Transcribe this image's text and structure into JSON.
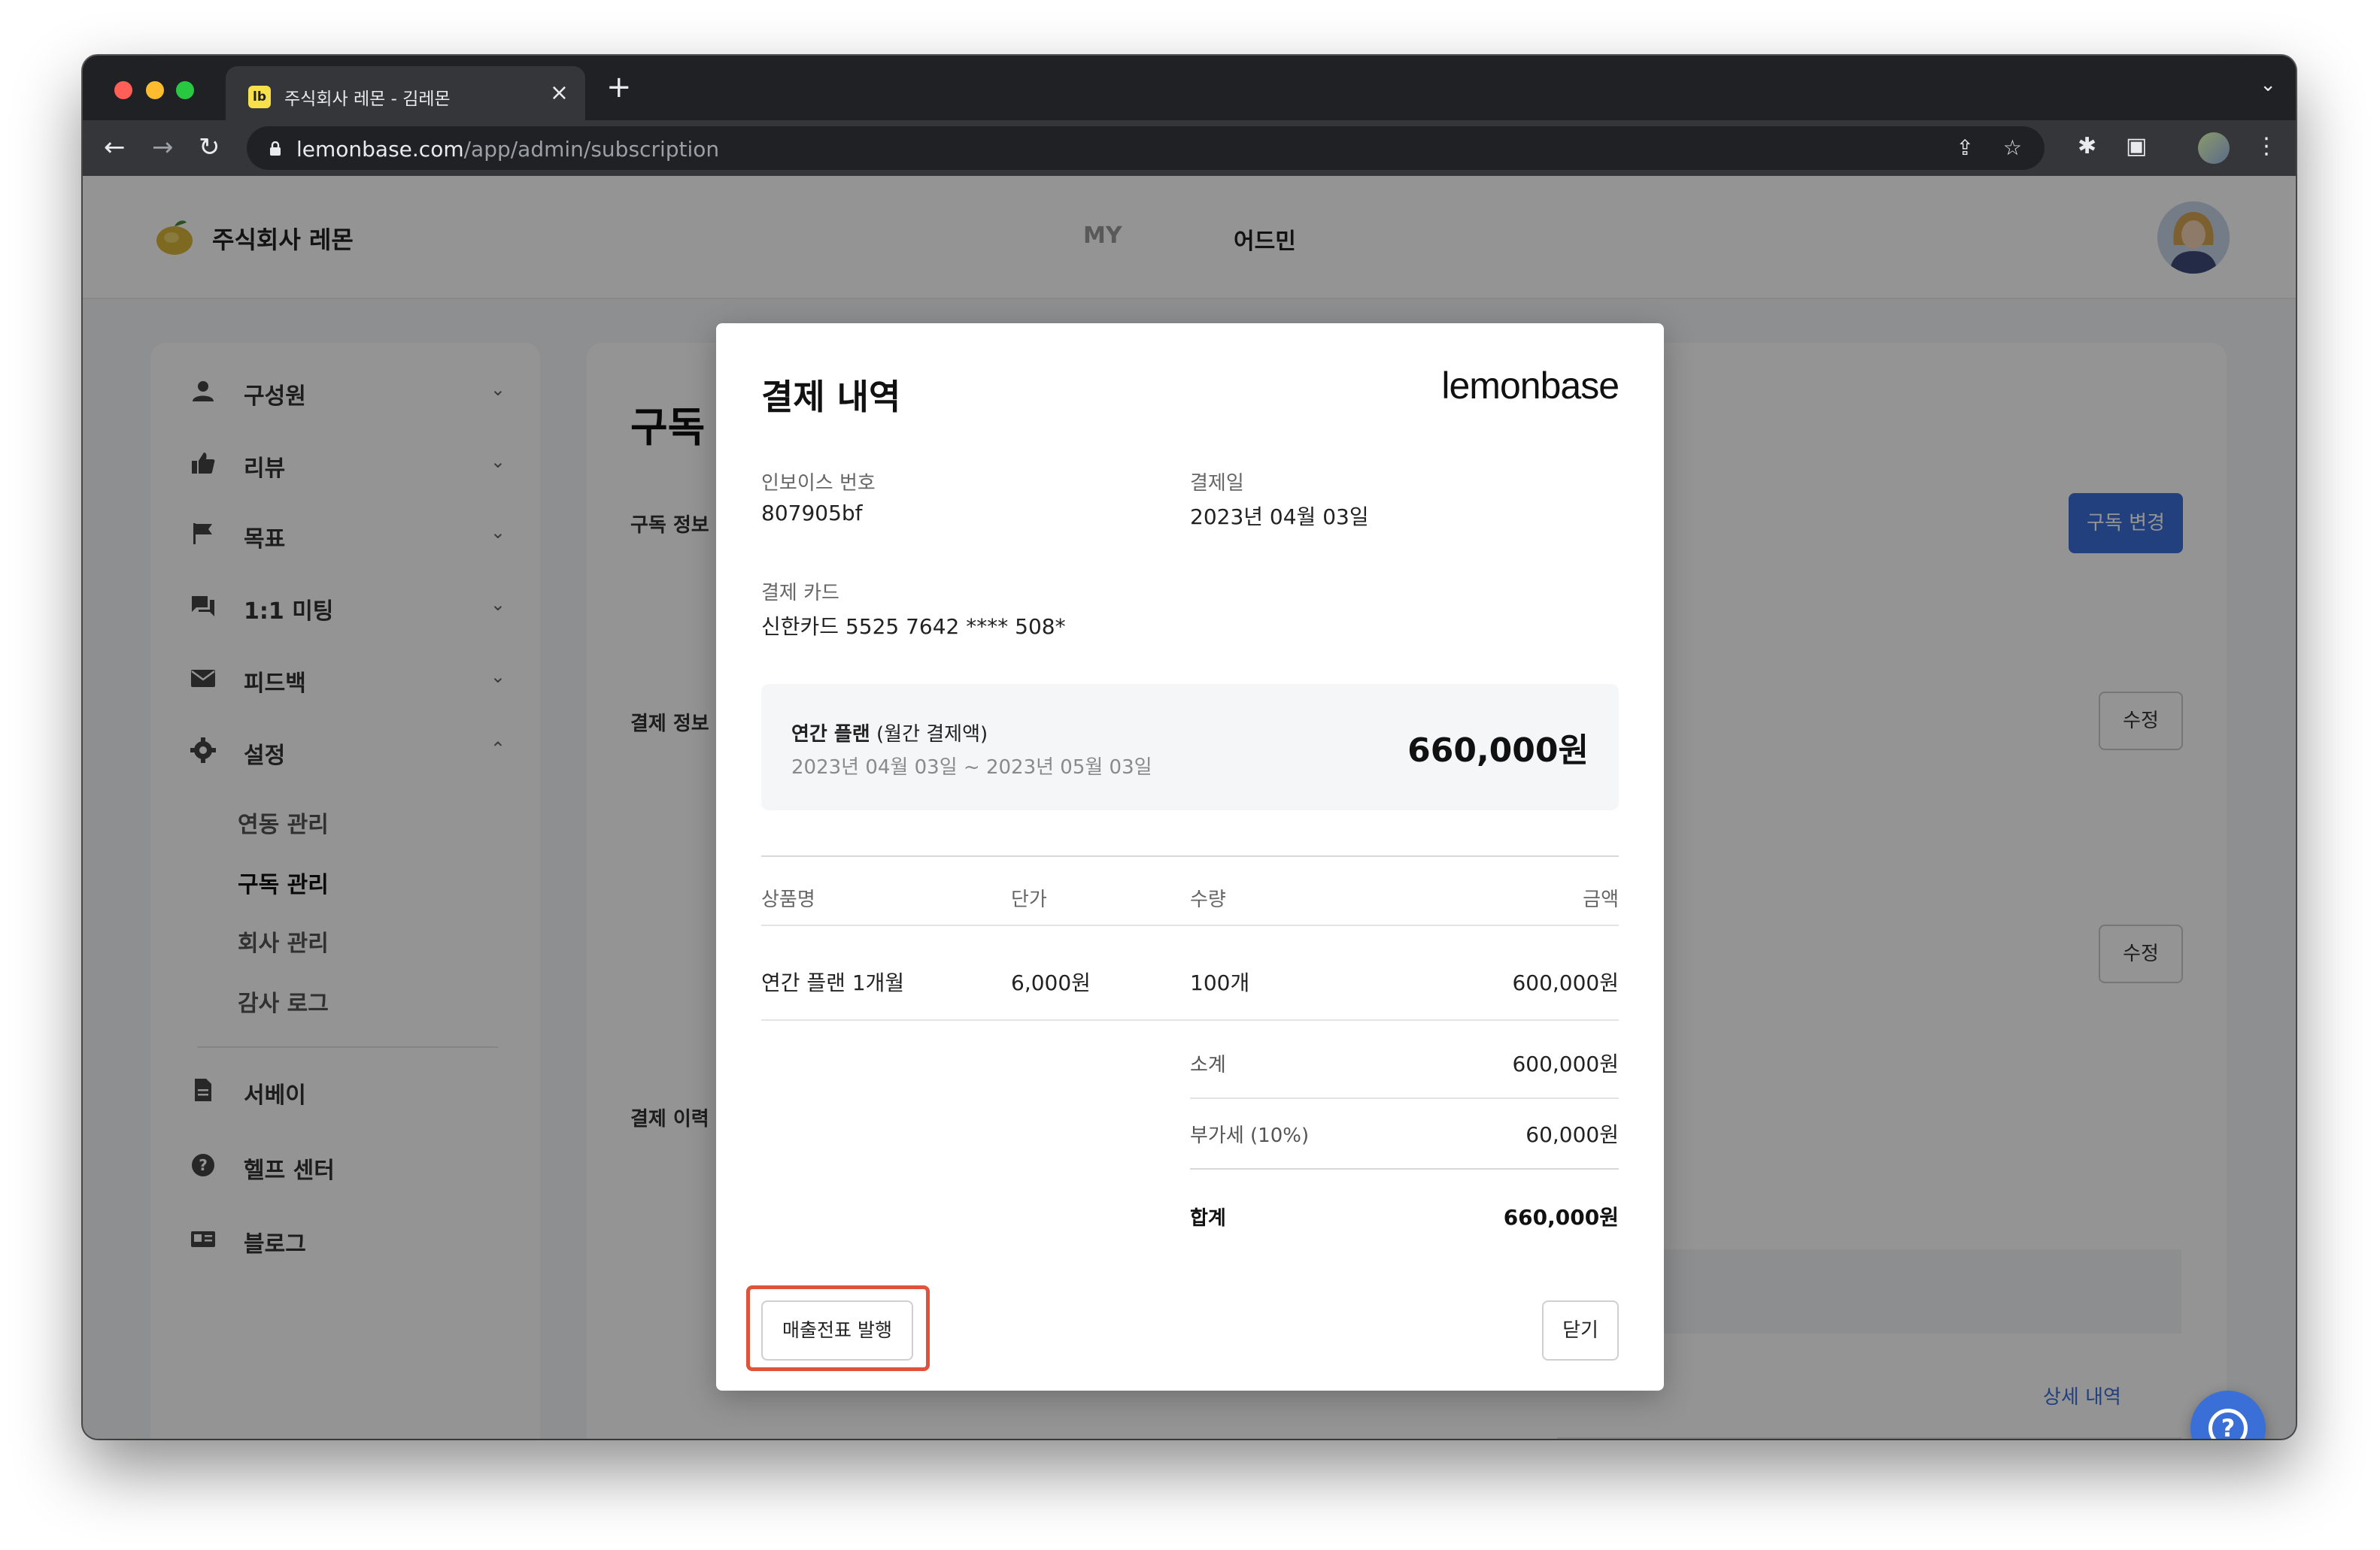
{
  "browser": {
    "tab_title": "주식회사 레몬 - 김레몬",
    "tab_favicon": "lb",
    "url_host": "lemonbase.com",
    "url_path": "/app/admin/subscription"
  },
  "header": {
    "company": "주식회사 레몬",
    "nav_my": "MY",
    "nav_admin": "어드민"
  },
  "sidebar": {
    "items": [
      {
        "label": "구성원",
        "icon": "person-icon"
      },
      {
        "label": "리뷰",
        "icon": "thumbs-up-icon"
      },
      {
        "label": "목표",
        "icon": "flag-icon"
      },
      {
        "label": "1:1 미팅",
        "icon": "chat-icon"
      },
      {
        "label": "피드백",
        "icon": "mail-icon"
      },
      {
        "label": "설정",
        "icon": "gear-icon"
      }
    ],
    "settings_sub": [
      "연동 관리",
      "구독 관리",
      "회사 관리",
      "감사 로그"
    ],
    "bottom": [
      {
        "label": "서베이",
        "icon": "document-icon"
      },
      {
        "label": "헬프 센터",
        "icon": "help-icon"
      },
      {
        "label": "블로그",
        "icon": "blog-icon"
      }
    ]
  },
  "content": {
    "title": "구독 관리",
    "sec_subscription": "구독 정보",
    "sec_payment": "결제 정보",
    "sec_history": "결제 이력",
    "change_button": "구독 변경",
    "edit_button": "수정",
    "detail_link": "상세 내역"
  },
  "modal": {
    "title": "결제 내역",
    "brand": "lemonbase",
    "invoice_label": "인보이스 번호",
    "invoice_value": "807905bf",
    "date_label": "결제일",
    "date_value": "2023년 04월 03일",
    "card_label": "결제 카드",
    "card_value": "신한카드 5525 7642 **** 508*",
    "plan_name": "연간 플랜",
    "plan_note": "(월간 결제액)",
    "plan_period": "2023년 04월 03일 ~ 2023년 05월 03일",
    "plan_amount": "660,000원",
    "table": {
      "headers": [
        "상품명",
        "단가",
        "수량",
        "금액"
      ],
      "row": [
        "연간 플랜 1개월",
        "6,000원",
        "100개",
        "600,000원"
      ]
    },
    "subtotal_label": "소계",
    "subtotal_value": "600,000원",
    "vat_label": "부가세 (10%)",
    "vat_value": "60,000원",
    "total_label": "합계",
    "total_value": "660,000원",
    "invoice_button": "매출전표 발행",
    "close_button": "닫기"
  },
  "colors": {
    "primary": "#3a6fd8",
    "highlight": "#e0533a"
  }
}
